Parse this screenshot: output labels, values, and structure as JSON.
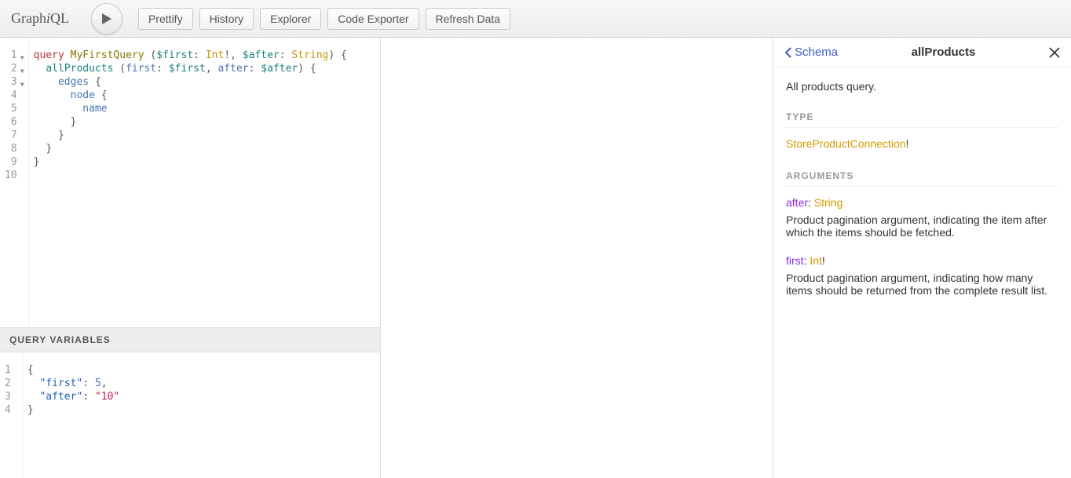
{
  "logo": {
    "pre": "Graph",
    "i": "i",
    "post": "QL"
  },
  "toolbar": {
    "prettify": "Prettify",
    "history": "History",
    "explorer": "Explorer",
    "export": "Code Exporter",
    "refresh": "Refresh Data"
  },
  "editor": {
    "gutter": [
      "1",
      "2",
      "3",
      "4",
      "5",
      "6",
      "7",
      "8",
      "9",
      "10"
    ],
    "foldLines": [
      0,
      1,
      2
    ],
    "tokens": [
      [
        [
          "tok-kw",
          "query"
        ],
        [
          "",
          " "
        ],
        [
          "tok-def",
          "MyFirstQuery"
        ],
        [
          "",
          " "
        ],
        [
          "tok-punc",
          "("
        ],
        [
          "tok-var",
          "$first"
        ],
        [
          "tok-punc",
          ": "
        ],
        [
          "tok-type",
          "Int"
        ],
        [
          "tok-punc",
          "!"
        ],
        [
          "tok-punc",
          ", "
        ],
        [
          "tok-var",
          "$after"
        ],
        [
          "tok-punc",
          ": "
        ],
        [
          "tok-type",
          "String"
        ],
        [
          "tok-punc",
          ") {"
        ]
      ],
      [
        [
          "",
          "  "
        ],
        [
          "tok-prop",
          "allProducts"
        ],
        [
          "",
          " "
        ],
        [
          "tok-punc",
          "("
        ],
        [
          "tok-attr",
          "first"
        ],
        [
          "tok-punc",
          ": "
        ],
        [
          "tok-var",
          "$first"
        ],
        [
          "tok-punc",
          ", "
        ],
        [
          "tok-attr",
          "after"
        ],
        [
          "tok-punc",
          ": "
        ],
        [
          "tok-var",
          "$after"
        ],
        [
          "tok-punc",
          ") {"
        ]
      ],
      [
        [
          "",
          "    "
        ],
        [
          "tok-attr",
          "edges"
        ],
        [
          "",
          " "
        ],
        [
          "tok-punc",
          "{"
        ]
      ],
      [
        [
          "",
          "      "
        ],
        [
          "tok-attr",
          "node"
        ],
        [
          "",
          " "
        ],
        [
          "tok-punc",
          "{"
        ]
      ],
      [
        [
          "",
          "        "
        ],
        [
          "tok-attr",
          "name"
        ]
      ],
      [
        [
          "",
          "      "
        ],
        [
          "tok-punc",
          "}"
        ]
      ],
      [
        [
          "",
          "    "
        ],
        [
          "tok-punc",
          "}"
        ]
      ],
      [
        [
          "",
          "  "
        ],
        [
          "tok-punc",
          "}"
        ]
      ],
      [
        [
          "tok-punc",
          "}"
        ]
      ],
      [
        [
          "",
          ""
        ]
      ]
    ]
  },
  "variables": {
    "header": "Query Variables",
    "gutter": [
      "1",
      "2",
      "3",
      "4"
    ],
    "tokens": [
      [
        [
          "tok-punc",
          "{"
        ]
      ],
      [
        [
          "",
          "  "
        ],
        [
          "tok-jkey",
          "\"first\""
        ],
        [
          "tok-punc",
          ": "
        ],
        [
          "tok-num",
          "5"
        ],
        [
          "tok-punc",
          ","
        ]
      ],
      [
        [
          "",
          "  "
        ],
        [
          "tok-jkey",
          "\"after\""
        ],
        [
          "tok-punc",
          ": "
        ],
        [
          "tok-str",
          "\"10\""
        ]
      ],
      [
        [
          "tok-punc",
          "}"
        ]
      ]
    ]
  },
  "docs": {
    "back": "Schema",
    "title": "allProducts",
    "description": "All products query.",
    "sect_type": "type",
    "type_name": "StoreProductConnection",
    "type_bang": "!",
    "sect_args": "arguments",
    "args": [
      {
        "name": "after",
        "sep": ": ",
        "type": "String",
        "bang": "",
        "desc": "Product pagination argument, indicating the item after which the items should be fetched."
      },
      {
        "name": "first",
        "sep": ": ",
        "type": "Int",
        "bang": "!",
        "desc": "Product pagination argument, indicating how many items should be returned from the complete result list."
      }
    ]
  }
}
